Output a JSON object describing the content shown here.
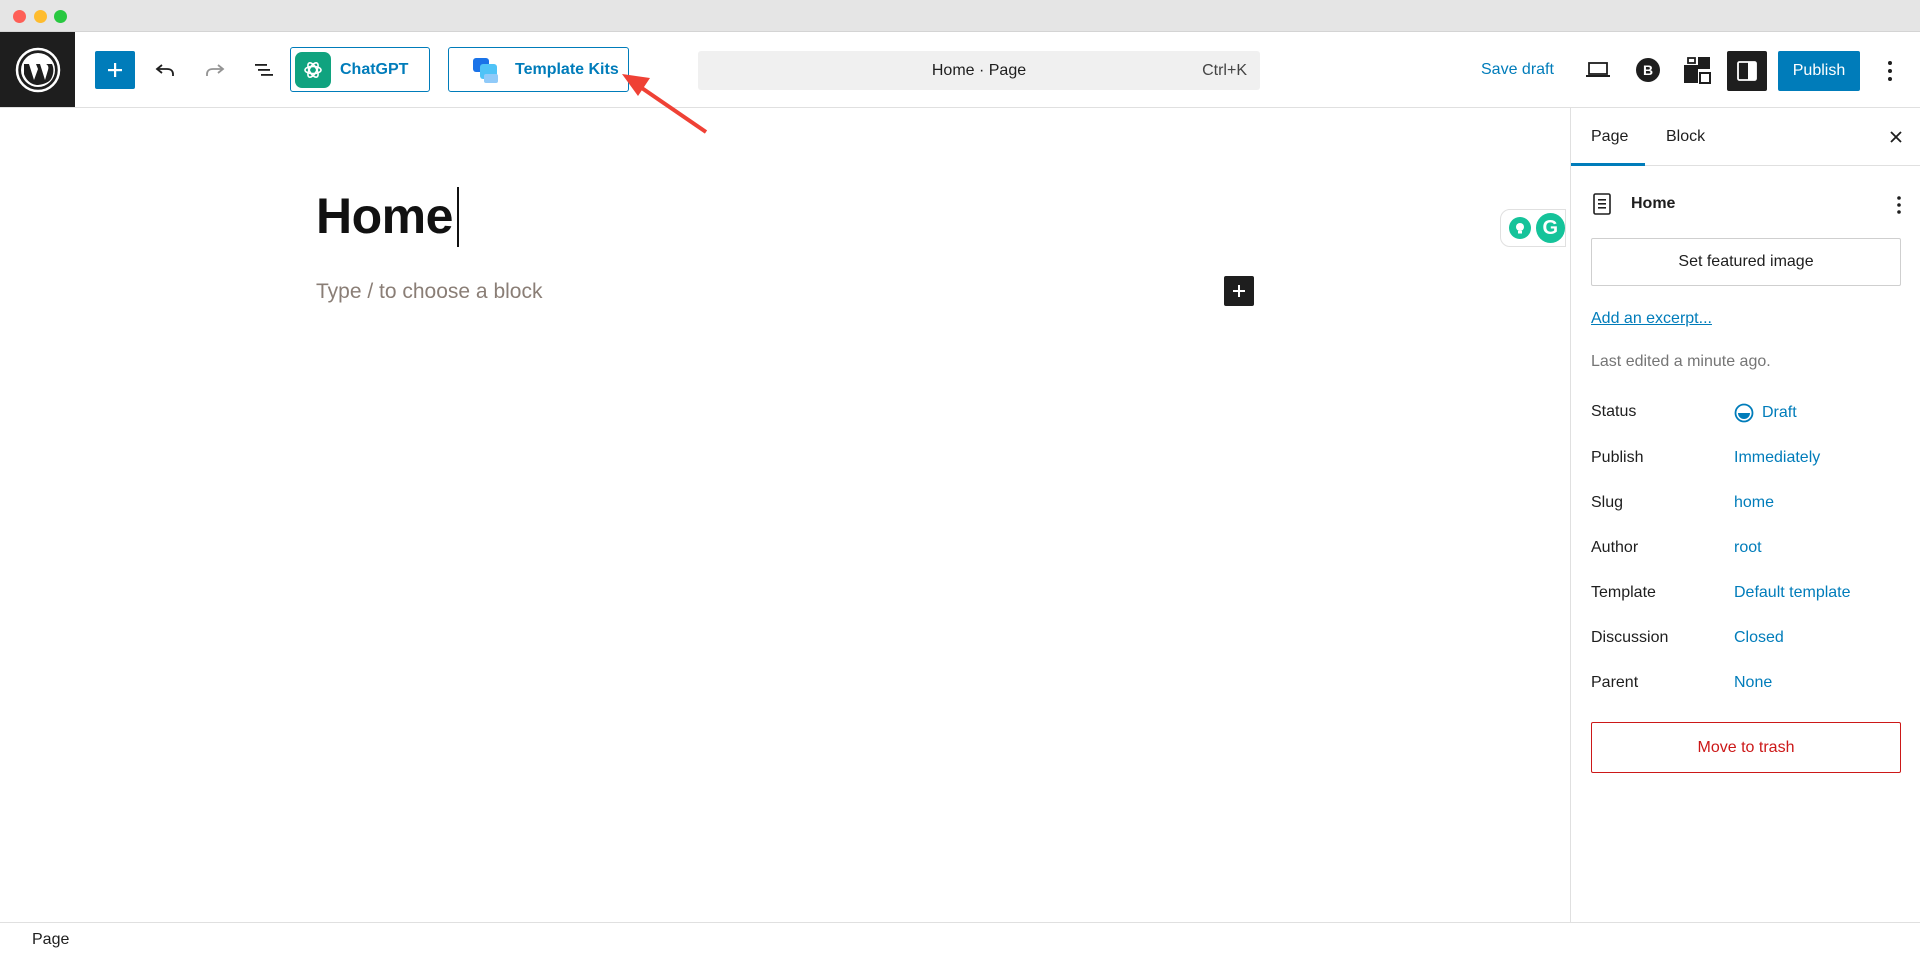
{
  "toolbar": {
    "chatgpt_label": "ChatGPT",
    "template_kits_label": "Template Kits",
    "command_title": "Home · Page",
    "command_shortcut": "Ctrl+K",
    "save_draft_label": "Save draft",
    "b_icon_label": "B",
    "publish_label": "Publish"
  },
  "editor": {
    "title": "Home",
    "block_placeholder": "Type / to choose a block",
    "grammarly_letter": "G"
  },
  "sidebar": {
    "tabs": [
      "Page",
      "Block"
    ],
    "active_tab": "Page",
    "doc_title": "Home",
    "featured_image_label": "Set featured image",
    "excerpt_link": "Add an excerpt...",
    "last_edited": "Last edited a minute ago.",
    "rows": [
      {
        "label": "Status",
        "value": "Draft"
      },
      {
        "label": "Publish",
        "value": "Immediately"
      },
      {
        "label": "Slug",
        "value": "home"
      },
      {
        "label": "Author",
        "value": "root"
      },
      {
        "label": "Template",
        "value": "Default template"
      },
      {
        "label": "Discussion",
        "value": "Closed"
      },
      {
        "label": "Parent",
        "value": "None"
      }
    ],
    "trash_label": "Move to trash"
  },
  "footer": {
    "breadcrumb": "Page"
  },
  "colors": {
    "accent": "#007cba",
    "dark": "#1e1e1e",
    "danger": "#cc1818",
    "chatgpt": "#10a37f",
    "grammarly": "#15c39a",
    "annotation_arrow": "#ef4135"
  }
}
